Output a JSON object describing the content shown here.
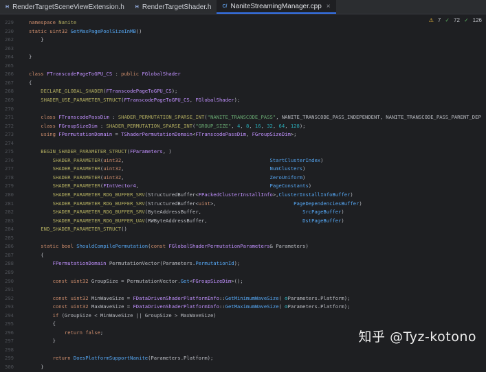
{
  "tabs": [
    {
      "label": "RenderTargetSceneViewExtension.h",
      "icon": "header-file-icon",
      "type": "h",
      "active": false
    },
    {
      "label": "RenderTargetShader.h",
      "icon": "header-file-icon",
      "type": "h",
      "active": false
    },
    {
      "label": "NaniteStreamingManager.cpp",
      "icon": "cpp-file-icon",
      "type": "cpp",
      "active": true
    }
  ],
  "inspections": {
    "warnings": "7",
    "weak_warnings": "72",
    "typos": "126"
  },
  "watermark": "知乎 @Tyz-kotono",
  "lines": [
    {
      "num": "229",
      "tokens": [
        [
          "k",
          "namespace "
        ],
        [
          "m",
          "Nanite"
        ]
      ]
    },
    {
      "num": "230",
      "tokens": [
        [
          "k",
          "static "
        ],
        [
          "k",
          "uint32 "
        ],
        [
          "f",
          "GetMaxPagePoolSizeInMB"
        ],
        [
          "p",
          "()"
        ]
      ]
    },
    {
      "num": "262",
      "tokens": [
        [
          "p",
          "    }"
        ]
      ]
    },
    {
      "num": "263",
      "tokens": []
    },
    {
      "num": "264",
      "tokens": [
        [
          "p",
          "}"
        ]
      ]
    },
    {
      "num": "265",
      "tokens": []
    },
    {
      "num": "266",
      "tokens": [
        [
          "k",
          "class "
        ],
        [
          "t",
          "FTranscodePageToGPU_CS"
        ],
        [
          "p",
          " : "
        ],
        [
          "k",
          "public "
        ],
        [
          "t",
          "FGlobalShader"
        ]
      ]
    },
    {
      "num": "267",
      "tokens": [
        [
          "p",
          "{"
        ]
      ]
    },
    {
      "num": "268",
      "tokens": [
        [
          "m",
          "    DECLARE_GLOBAL_SHADER"
        ],
        [
          "p",
          "("
        ],
        [
          "t",
          "FTranscodePageToGPU_CS"
        ],
        [
          "p",
          ");"
        ]
      ]
    },
    {
      "num": "269",
      "tokens": [
        [
          "m",
          "    SHADER_USE_PARAMETER_STRUCT"
        ],
        [
          "p",
          "("
        ],
        [
          "t",
          "FTranscodePageToGPU_CS"
        ],
        [
          "p",
          ", "
        ],
        [
          "t",
          "FGlobalShader"
        ],
        [
          "p",
          ");"
        ]
      ]
    },
    {
      "num": "270",
      "tokens": []
    },
    {
      "num": "271",
      "tokens": [
        [
          "k",
          "    class "
        ],
        [
          "t",
          "FTranscodePassDim"
        ],
        [
          "p",
          " : "
        ],
        [
          "m",
          "SHADER_PERMUTATION_SPARSE_INT"
        ],
        [
          "p",
          "("
        ],
        [
          "s",
          "\"NANITE_TRANSCODE_PASS\""
        ],
        [
          "p",
          ", NANITE_TRANSCODE_PASS_INDEPENDENT, NANITE_TRANSCODE_PASS_PARENT_DEP"
        ]
      ]
    },
    {
      "num": "272",
      "tokens": [
        [
          "k",
          "    class "
        ],
        [
          "t",
          "FGroupSizeDim"
        ],
        [
          "p",
          " : "
        ],
        [
          "m",
          "SHADER_PERMUTATION_SPARSE_INT"
        ],
        [
          "p",
          "("
        ],
        [
          "s",
          "\"GROUP_SIZE\""
        ],
        [
          "p",
          ", "
        ],
        [
          "n",
          "4"
        ],
        [
          "p",
          ", "
        ],
        [
          "n",
          "8"
        ],
        [
          "p",
          ", "
        ],
        [
          "n",
          "16"
        ],
        [
          "p",
          ", "
        ],
        [
          "n",
          "32"
        ],
        [
          "p",
          ", "
        ],
        [
          "n",
          "64"
        ],
        [
          "p",
          ", "
        ],
        [
          "n",
          "128"
        ],
        [
          "p",
          ");"
        ]
      ]
    },
    {
      "num": "273",
      "tokens": [
        [
          "k",
          "    using "
        ],
        [
          "t",
          "FPermutationDomain"
        ],
        [
          "p",
          " = "
        ],
        [
          "t",
          "TShaderPermutationDomain"
        ],
        [
          "p",
          "<"
        ],
        [
          "t",
          "FTranscodePassDim"
        ],
        [
          "p",
          ", "
        ],
        [
          "t",
          "FGroupSizeDim"
        ],
        [
          "p",
          ">;"
        ]
      ]
    },
    {
      "num": "274",
      "tokens": []
    },
    {
      "num": "275",
      "tokens": [
        [
          "m",
          "    BEGIN_SHADER_PARAMETER_STRUCT"
        ],
        [
          "p",
          "("
        ],
        [
          "t",
          "FParameters"
        ],
        [
          "p",
          ", )"
        ]
      ]
    },
    {
      "num": "276",
      "tokens": [
        [
          "m",
          "        SHADER_PARAMETER"
        ],
        [
          "p",
          "("
        ],
        [
          "k",
          "uint32"
        ],
        [
          "p",
          ",                                                 "
        ],
        [
          "pm",
          "StartClusterIndex"
        ],
        [
          "p",
          ")"
        ]
      ]
    },
    {
      "num": "277",
      "tokens": [
        [
          "m",
          "        SHADER_PARAMETER"
        ],
        [
          "p",
          "("
        ],
        [
          "k",
          "uint32"
        ],
        [
          "p",
          ",                                                 "
        ],
        [
          "pm",
          "NumClusters"
        ],
        [
          "p",
          ")"
        ]
      ]
    },
    {
      "num": "278",
      "tokens": [
        [
          "m",
          "        SHADER_PARAMETER"
        ],
        [
          "p",
          "("
        ],
        [
          "k",
          "uint32"
        ],
        [
          "p",
          ",                                                 "
        ],
        [
          "pm",
          "ZeroUniform"
        ],
        [
          "p",
          ")"
        ]
      ]
    },
    {
      "num": "279",
      "tokens": [
        [
          "m",
          "        SHADER_PARAMETER"
        ],
        [
          "p",
          "("
        ],
        [
          "t",
          "FIntVector4"
        ],
        [
          "p",
          ",                                            "
        ],
        [
          "pm",
          "PageConstants"
        ],
        [
          "p",
          ")"
        ]
      ]
    },
    {
      "num": "280",
      "tokens": [
        [
          "m",
          "        SHADER_PARAMETER_RDG_BUFFER_SRV"
        ],
        [
          "p",
          "(StructuredBuffer<"
        ],
        [
          "t",
          "FPackedClusterInstallInfo"
        ],
        [
          "p",
          ">,"
        ],
        [
          "pm",
          "ClusterInstallInfoBuffer"
        ],
        [
          "p",
          ")"
        ]
      ]
    },
    {
      "num": "281",
      "tokens": [
        [
          "m",
          "        SHADER_PARAMETER_RDG_BUFFER_SRV"
        ],
        [
          "p",
          "(StructuredBuffer<"
        ],
        [
          "k",
          "uint"
        ],
        [
          "p",
          ">,                          "
        ],
        [
          "pm",
          "PageDependenciesBuffer"
        ],
        [
          "p",
          ")"
        ]
      ]
    },
    {
      "num": "282",
      "tokens": [
        [
          "m",
          "        SHADER_PARAMETER_RDG_BUFFER_SRV"
        ],
        [
          "p",
          "(ByteAddressBuffer,                                  "
        ],
        [
          "pm",
          "SrcPageBuffer"
        ],
        [
          "p",
          ")"
        ]
      ]
    },
    {
      "num": "283",
      "tokens": [
        [
          "m",
          "        SHADER_PARAMETER_RDG_BUFFER_UAV"
        ],
        [
          "p",
          "(RWByteAddressBuffer,                                "
        ],
        [
          "pm",
          "DstPageBuffer"
        ],
        [
          "p",
          ")"
        ]
      ]
    },
    {
      "num": "284",
      "tokens": [
        [
          "m",
          "    END_SHADER_PARAMETER_STRUCT"
        ],
        [
          "p",
          "()"
        ]
      ]
    },
    {
      "num": "285",
      "tokens": []
    },
    {
      "num": "286",
      "tokens": [
        [
          "k",
          "    static bool "
        ],
        [
          "f",
          "ShouldCompilePermutation"
        ],
        [
          "p",
          "("
        ],
        [
          "k",
          "const "
        ],
        [
          "t",
          "FGlobalShaderPermutationParameters"
        ],
        [
          "p",
          "& Parameters)"
        ]
      ]
    },
    {
      "num": "287",
      "tokens": [
        [
          "p",
          "    {"
        ]
      ]
    },
    {
      "num": "288",
      "tokens": [
        [
          "t",
          "        FPermutationDomain "
        ],
        [
          "p",
          "PermutationVector(Parameters."
        ],
        [
          "pm",
          "PermutationId"
        ],
        [
          "p",
          ");"
        ]
      ]
    },
    {
      "num": "289",
      "tokens": []
    },
    {
      "num": "290",
      "tokens": [
        [
          "k",
          "        const uint32 "
        ],
        [
          "p",
          "GroupSize = PermutationVector."
        ],
        [
          "f",
          "Get"
        ],
        [
          "p",
          "<"
        ],
        [
          "t",
          "FGroupSizeDim"
        ],
        [
          "p",
          ">();"
        ]
      ]
    },
    {
      "num": "291",
      "tokens": []
    },
    {
      "num": "292",
      "tokens": [
        [
          "k",
          "        const uint32 "
        ],
        [
          "p",
          "MinWaveSize = "
        ],
        [
          "t",
          "FDataDrivenShaderPlatformInfo"
        ],
        [
          "p",
          "::"
        ],
        [
          "f",
          "GetMinimumWaveSize"
        ],
        [
          "p",
          "( "
        ],
        [
          "n",
          "⚙"
        ],
        [
          "p",
          "Parameters.Platform);"
        ]
      ]
    },
    {
      "num": "293",
      "tokens": [
        [
          "k",
          "        const uint32 "
        ],
        [
          "p",
          "MaxWaveSize = "
        ],
        [
          "t",
          "FDataDrivenShaderPlatformInfo"
        ],
        [
          "p",
          "::"
        ],
        [
          "f",
          "GetMaximumWaveSize"
        ],
        [
          "p",
          "( "
        ],
        [
          "n",
          "⚙"
        ],
        [
          "p",
          "Parameters.Platform);"
        ]
      ]
    },
    {
      "num": "294",
      "tokens": [
        [
          "k",
          "        if "
        ],
        [
          "p",
          "(GroupSize < MinWaveSize || GroupSize > MaxWaveSize)"
        ]
      ]
    },
    {
      "num": "295",
      "tokens": [
        [
          "p",
          "        {"
        ]
      ]
    },
    {
      "num": "296",
      "tokens": [
        [
          "k",
          "            return false"
        ],
        [
          "p",
          ";"
        ]
      ]
    },
    {
      "num": "297",
      "tokens": [
        [
          "p",
          "        }"
        ]
      ]
    },
    {
      "num": "298",
      "tokens": []
    },
    {
      "num": "299",
      "tokens": [
        [
          "k",
          "        return "
        ],
        [
          "f",
          "DoesPlatformSupportNanite"
        ],
        [
          "p",
          "(Parameters.Platform);"
        ]
      ]
    },
    {
      "num": "300",
      "tokens": [
        [
          "p",
          "    }"
        ]
      ]
    }
  ]
}
